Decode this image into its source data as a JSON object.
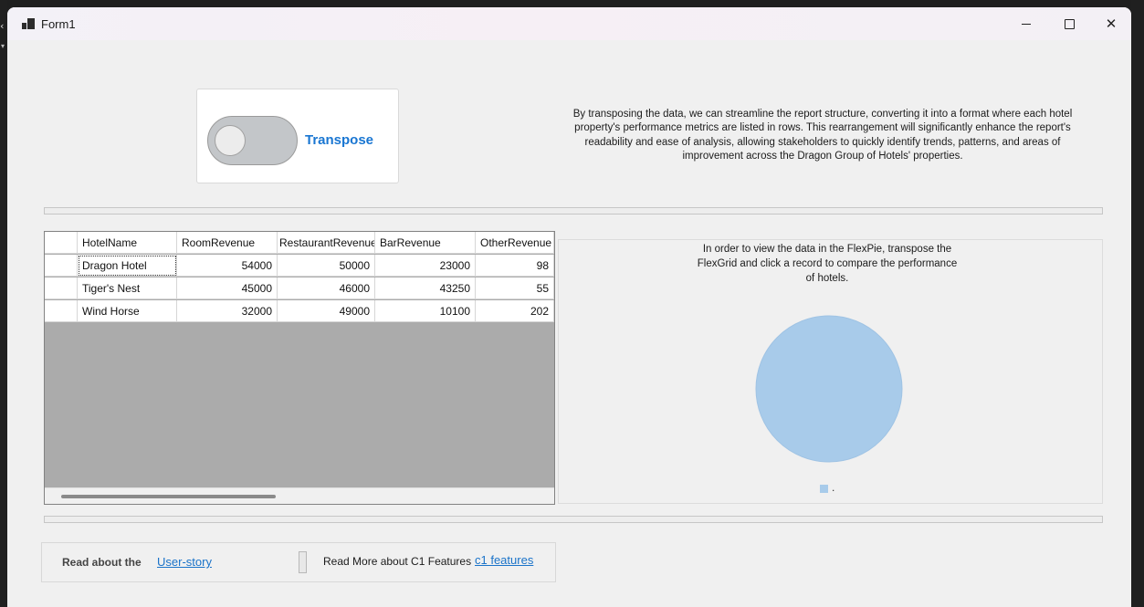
{
  "window": {
    "title": "Form1",
    "controls": {
      "minimize": "minimize",
      "maximize": "maximize",
      "close": "✕"
    }
  },
  "transpose": {
    "label": "Transpose",
    "checked": false,
    "accent": "#1976d2"
  },
  "description": "By transposing the data, we can streamline the report structure, converting it into a format where each hotel property's performance metrics are listed in rows. This rearrangement will significantly enhance the report's readability and ease of analysis, allowing stakeholders to quickly identify trends, patterns, and areas of improvement across the Dragon Group of Hotels' properties.",
  "grid": {
    "columns": [
      "HotelName",
      "RoomRevenue",
      "RestaurantRevenue",
      "BarRevenue",
      "OtherRevenue"
    ],
    "rows": [
      [
        "Dragon Hotel",
        "54000",
        "50000",
        "23000",
        "98"
      ],
      [
        "Tiger's Nest",
        "45000",
        "46000",
        "43250",
        "55"
      ],
      [
        "Wind Horse",
        "32000",
        "49000",
        "10100",
        "202"
      ]
    ]
  },
  "pie": {
    "message": "In order to view the data in the FlexPie, transpose the FlexGrid and click a record to compare the performance of hotels.",
    "slice_color": "#a8cbea",
    "legend_label": "."
  },
  "footer": {
    "read_about": "Read about the",
    "user_story_link": "User-story",
    "read_more": "Read More about C1 Features",
    "c1_link": "c1 features",
    "link_color": "#1a73c9"
  }
}
